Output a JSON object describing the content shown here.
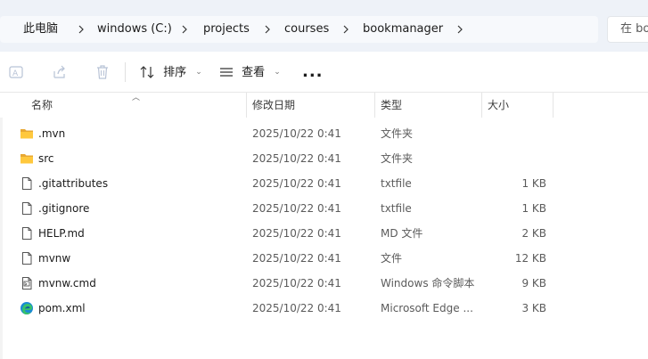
{
  "breadcrumb": [
    {
      "label": "此电脑"
    },
    {
      "label": "windows (C:)"
    },
    {
      "label": "projects"
    },
    {
      "label": "courses"
    },
    {
      "label": "bookmanager"
    }
  ],
  "search": {
    "placeholder": "在 bookmanager 中搜索"
  },
  "toolbar": {
    "sort_label": "排序",
    "view_label": "查看",
    "more_label": "..."
  },
  "columns": {
    "name": "名称",
    "date": "修改日期",
    "type": "类型",
    "size": "大小"
  },
  "files": [
    {
      "name": ".mvn",
      "date": "2025/10/22 0:41",
      "type": "文件夹",
      "size": "",
      "icon": "folder-icon"
    },
    {
      "name": "src",
      "date": "2025/10/22 0:41",
      "type": "文件夹",
      "size": "",
      "icon": "folder-icon"
    },
    {
      "name": ".gitattributes",
      "date": "2025/10/22 0:41",
      "type": "txtfile",
      "size": "1 KB",
      "icon": "file-icon"
    },
    {
      "name": ".gitignore",
      "date": "2025/10/22 0:41",
      "type": "txtfile",
      "size": "1 KB",
      "icon": "file-icon"
    },
    {
      "name": "HELP.md",
      "date": "2025/10/22 0:41",
      "type": "MD 文件",
      "size": "2 KB",
      "icon": "file-icon"
    },
    {
      "name": "mvnw",
      "date": "2025/10/22 0:41",
      "type": "文件",
      "size": "12 KB",
      "icon": "file-icon"
    },
    {
      "name": "mvnw.cmd",
      "date": "2025/10/22 0:41",
      "type": "Windows 命令脚本",
      "size": "9 KB",
      "icon": "cmd-file-icon"
    },
    {
      "name": "pom.xml",
      "date": "2025/10/22 0:41",
      "type": "Microsoft Edge ...",
      "size": "3 KB",
      "icon": "edge-icon"
    }
  ]
}
